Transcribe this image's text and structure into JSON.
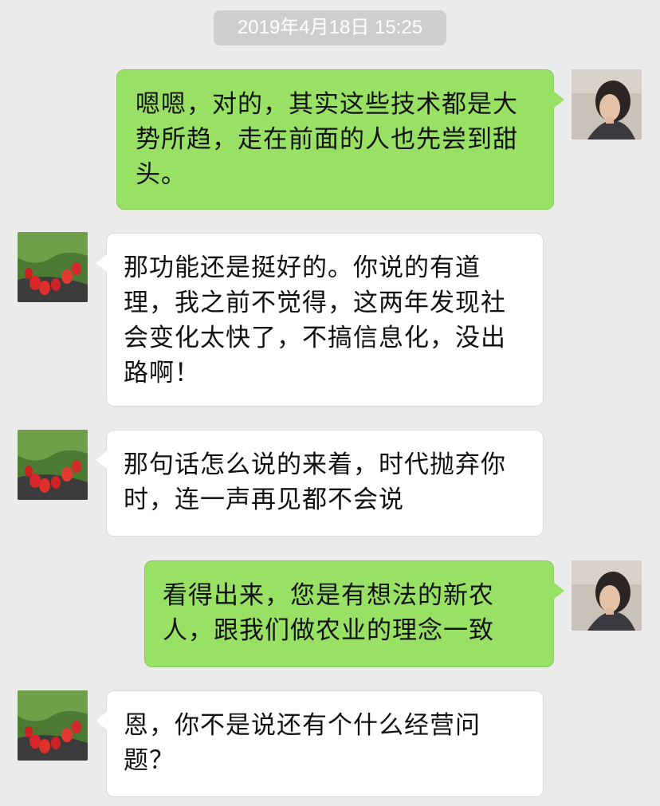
{
  "timestamp": "2019年4月18日 15:25",
  "avatars": {
    "self": "woman-portrait-avatar",
    "contact": "strawberry-field-avatar"
  },
  "colors": {
    "background": "#ebebeb",
    "sent_bubble": "#98e165",
    "received_bubble": "#ffffff",
    "timestamp_bg": "#cecece"
  },
  "messages": [
    {
      "sender": "self",
      "text": "嗯嗯，对的，其实这些技术都是大势所趋，走在前面的人也先尝到甜头。"
    },
    {
      "sender": "contact",
      "text": "那功能还是挺好的。你说的有道理，我之前不觉得，这两年发现社会变化太快了，不搞信息化，没出路啊！"
    },
    {
      "sender": "contact",
      "text": "那句话怎么说的来着，时代抛弃你时，连一声再见都不会说"
    },
    {
      "sender": "self",
      "text": "看得出来，您是有想法的新农人，跟我们做农业的理念一致"
    },
    {
      "sender": "contact",
      "text": "恩，你不是说还有个什么经营问题？"
    }
  ]
}
